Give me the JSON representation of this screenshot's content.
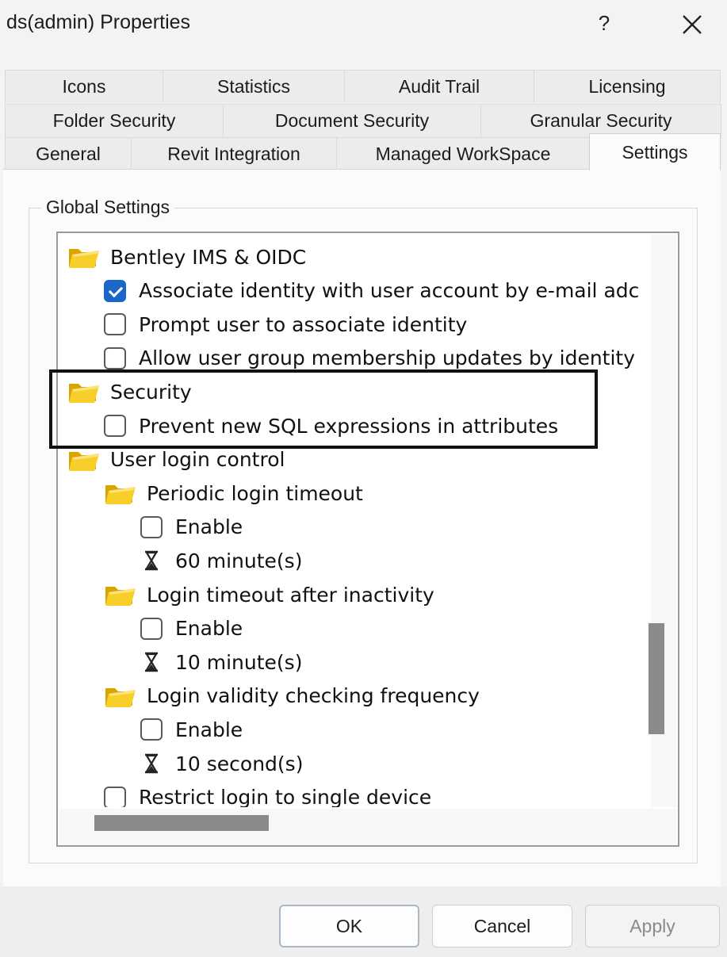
{
  "window": {
    "title": "ds(admin) Properties",
    "help_label": "?",
    "close_icon": "close-icon"
  },
  "tabs": {
    "row1": [
      "Icons",
      "Statistics",
      "Audit Trail",
      "Licensing"
    ],
    "row2": [
      "Folder Security",
      "Document Security",
      "Granular Security"
    ],
    "row3": [
      "General",
      "Revit Integration",
      "Managed WorkSpace",
      "Settings"
    ],
    "active": "Settings"
  },
  "group": {
    "label": "Global Settings"
  },
  "tree": [
    {
      "kind": "folder",
      "text": "Bentley IMS & OIDC",
      "level": 0
    },
    {
      "kind": "checkbox",
      "text": "Associate identity with user account by e-mail adc",
      "checked": true,
      "level": 1
    },
    {
      "kind": "checkbox",
      "text": "Prompt user to associate identity",
      "checked": false,
      "level": 1
    },
    {
      "kind": "checkbox",
      "text": "Allow user group membership updates by identity",
      "checked": false,
      "level": 1
    },
    {
      "kind": "folder",
      "text": "Security",
      "level": 0
    },
    {
      "kind": "checkbox",
      "text": "Prevent new SQL expressions in attributes",
      "checked": false,
      "level": 1
    },
    {
      "kind": "folder",
      "text": "User login control",
      "level": 0
    },
    {
      "kind": "folder",
      "text": "Periodic login timeout",
      "level": 1
    },
    {
      "kind": "checkbox",
      "text": "Enable",
      "checked": false,
      "level": 2
    },
    {
      "kind": "value",
      "text": "60 minute(s)",
      "level": 2
    },
    {
      "kind": "folder",
      "text": "Login timeout after inactivity",
      "level": 1
    },
    {
      "kind": "checkbox",
      "text": "Enable",
      "checked": false,
      "level": 2
    },
    {
      "kind": "value",
      "text": "10 minute(s)",
      "level": 2
    },
    {
      "kind": "folder",
      "text": "Login validity checking frequency",
      "level": 1
    },
    {
      "kind": "checkbox",
      "text": "Enable",
      "checked": false,
      "level": 2
    },
    {
      "kind": "value",
      "text": "10 second(s)",
      "level": 2
    },
    {
      "kind": "checkbox",
      "text": "Restrict login to single device",
      "checked": false,
      "level": 1
    }
  ],
  "buttons": {
    "ok": "OK",
    "cancel": "Cancel",
    "apply": "Apply"
  },
  "colors": {
    "accent": "#1a66c9",
    "folder": "#f2c200",
    "highlight_border": "#111111"
  }
}
